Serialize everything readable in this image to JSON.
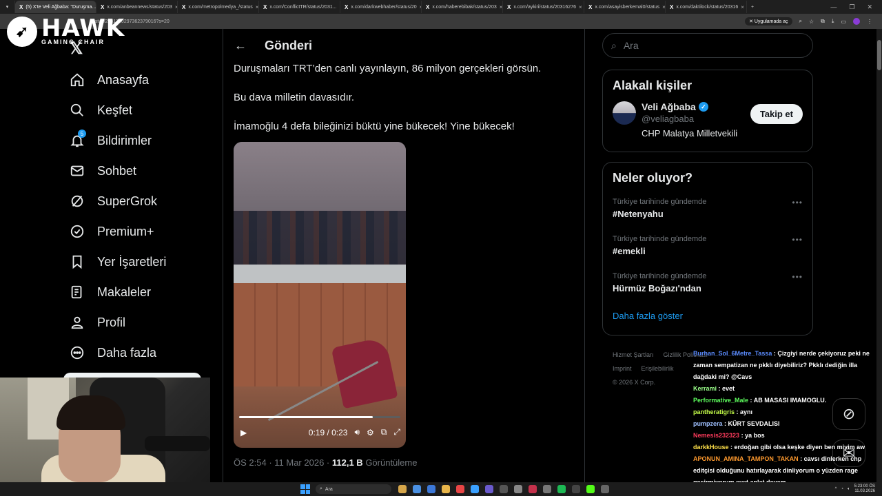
{
  "browser": {
    "tabs": [
      {
        "label": "(5) X'te Veli Ağbaba: \"Duruşma...",
        "active": true
      },
      {
        "label": "x.com/anbeannews/status/203",
        "active": false
      },
      {
        "label": "x.com/metropolmedya_/status",
        "active": false
      },
      {
        "label": "x.com/ConflictTR/status/2031...",
        "active": false
      },
      {
        "label": "x.com/darkwebhaber/status/20",
        "active": false
      },
      {
        "label": "x.com/haberebibak/status/203",
        "active": false
      },
      {
        "label": "x.com/aykiri/status/20316276",
        "active": false
      },
      {
        "label": "x.com/asayisberkemal0/status",
        "active": false
      },
      {
        "label": "x.com/daktilock/status/20316",
        "active": false
      }
    ],
    "url": "/status/2031700297362379016?s=20",
    "app_pill": "Uygulamada aç"
  },
  "overlay_logo": {
    "name": "HAWK",
    "sub": "GAMING CHAIR"
  },
  "nav": {
    "items": [
      {
        "label": "Anasayfa",
        "icon": "home-icon"
      },
      {
        "label": "Keşfet",
        "icon": "search-icon"
      },
      {
        "label": "Bildirimler",
        "icon": "bell-icon",
        "badge": "5"
      },
      {
        "label": "Sohbet",
        "icon": "mail-icon"
      },
      {
        "label": "SuperGrok",
        "icon": "grok-icon"
      },
      {
        "label": "Premium+",
        "icon": "verified-icon"
      },
      {
        "label": "Yer İşaretleri",
        "icon": "bookmark-icon"
      },
      {
        "label": "Makaleler",
        "icon": "article-icon"
      },
      {
        "label": "Profil",
        "icon": "person-icon"
      },
      {
        "label": "Daha fazla",
        "icon": "more-icon"
      }
    ]
  },
  "post": {
    "header": "Gönderi",
    "paragraphs": [
      "Duruşmaları TRT’den canlı yayınlayın, 86 milyon gerçekleri görsün.",
      "Bu dava milletin davasıdır.",
      "İmamoğlu 4 defa bileğinizi büktü yine bükecek! Yine bükecek!"
    ],
    "video": {
      "time": "0:19 / 0:23",
      "progress": 0.83
    },
    "time": "ÖS 2:54",
    "date": "11 Mar 2026",
    "views": "112,1 B",
    "views_label": "Görüntüleme"
  },
  "search": {
    "placeholder": "Ara"
  },
  "related": {
    "title": "Alakalı kişiler",
    "name": "Veli Ağbaba",
    "handle": "@veliagbaba",
    "bio": "CHP Malatya Milletvekili",
    "follow_label": "Takip et"
  },
  "trends": {
    "title": "Neler oluyor?",
    "items": [
      {
        "category": "Türkiye tarihinde gündemde",
        "name": "#Netenyahu"
      },
      {
        "category": "Türkiye tarihinde gündemde",
        "name": "#emekli"
      },
      {
        "category": "Türkiye tarihinde gündemde",
        "name": "Hürmüz Boğazı'ndan"
      }
    ],
    "show_more": "Daha fazla göster"
  },
  "footer": {
    "links": [
      "Hizmet Şartları",
      "Gizlilik Politikası",
      "Imprint",
      "Erişilebilirlik"
    ],
    "copyright": "© 2026 X Corp."
  },
  "chat": [
    {
      "user": "Burhan_Sol_6Metre_Tassa",
      "color": "#5b8cff",
      "text": "Çizgiyi nerde çekiyoruz peki ne zaman sempatizan ne pkklı diyebiliriz? Pkklı dediğin illa dağdaki mi? @Cavs"
    },
    {
      "user": "Kerrami",
      "color": "#9bff8a",
      "text": "evet"
    },
    {
      "user": "Performative_Male",
      "color": "#5eff5e",
      "text": "AB MASASI IMAMOGLU."
    },
    {
      "user": "pantheratigris",
      "color": "#c6ff4a",
      "text": "aynı"
    },
    {
      "user": "pumpzera",
      "color": "#9fc0ff",
      "text": "KÜRT SEVDALISI"
    },
    {
      "user": "Nemesis232323",
      "color": "#ff3b5c",
      "text": "ya bos"
    },
    {
      "user": "darkkHouse",
      "color": "#ffe14a",
      "text": "erdoğan gibi olsa keşke diyen ben miyim aw"
    },
    {
      "user": "APONUN_AMINA_TAMPON_TAKAN",
      "color": "#ff9a2e",
      "text": "cavsı dinlerken chp editçisi olduğunu hatırlayarak dinliyorum o yüzden rage geçirmiyorum evet anlat devam"
    }
  ],
  "taskbar": {
    "search": "Ara",
    "time": "5:23:00 ÖS",
    "date": "11.03.2026"
  }
}
